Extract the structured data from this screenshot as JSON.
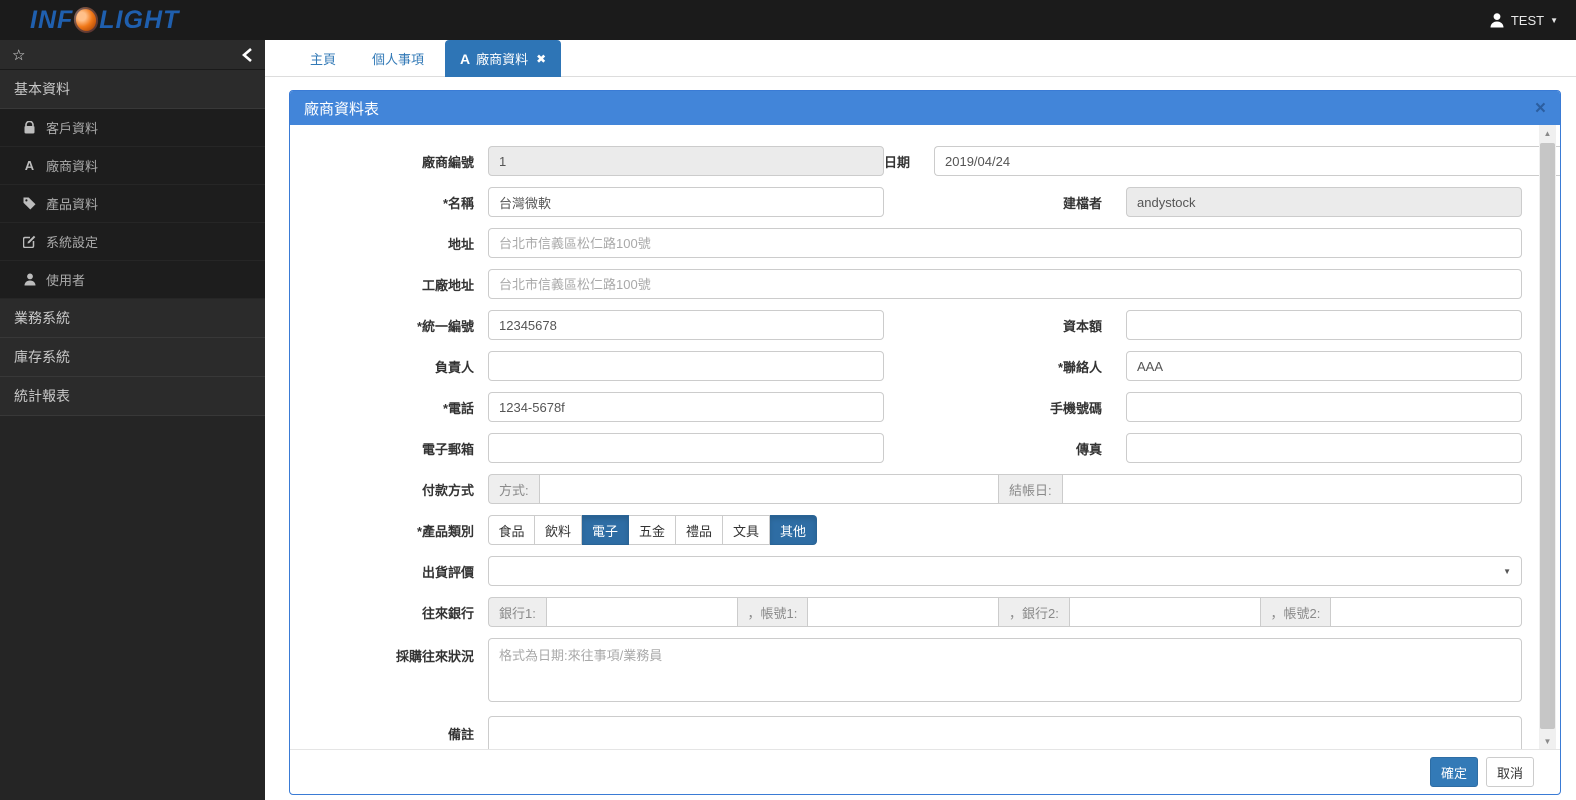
{
  "topbar": {
    "logo": {
      "part1": "INF",
      "part2": "LIGHT"
    },
    "user": {
      "name": "TEST"
    }
  },
  "sidebar": {
    "sections": [
      {
        "label": "基本資料",
        "items": [
          {
            "icon": "lock-icon",
            "label": "客戶資料"
          },
          {
            "icon": "font-a-icon",
            "label": "廠商資料"
          },
          {
            "icon": "tag-icon",
            "label": "產品資料"
          },
          {
            "icon": "edit-icon",
            "label": "系統設定"
          },
          {
            "icon": "user-icon",
            "label": "使用者"
          }
        ]
      },
      {
        "label": "業務系統",
        "items": []
      },
      {
        "label": "庫存系統",
        "items": []
      },
      {
        "label": "統計報表",
        "items": []
      }
    ]
  },
  "tabs": {
    "home": {
      "label": "主頁"
    },
    "personal": {
      "label": "個人事項"
    },
    "vendor": {
      "label": "廠商資料",
      "icon": "font-a-icon",
      "close": "✖",
      "active": true
    }
  },
  "modal": {
    "title": "廠商資料表",
    "close": "×",
    "fields": {
      "vendor_id": {
        "label": "廠商編號",
        "value": "1",
        "disabled": true
      },
      "date": {
        "label": "日期",
        "value": "2019/04/24"
      },
      "name": {
        "label": "*名稱",
        "value": "台灣微軟"
      },
      "creator": {
        "label": "建檔者",
        "value": "andystock",
        "disabled": true
      },
      "address": {
        "label": "地址",
        "placeholder": "台北市信義區松仁路100號"
      },
      "factory_address": {
        "label": "工廠地址",
        "placeholder": "台北市信義區松仁路100號"
      },
      "tax_id": {
        "label": "*統一編號",
        "value": "12345678"
      },
      "capital": {
        "label": "資本額",
        "value": ""
      },
      "owner": {
        "label": "負責人",
        "value": ""
      },
      "contact": {
        "label": "*聯絡人",
        "value": "AAA"
      },
      "phone": {
        "label": "*電話",
        "value": "1234-5678f"
      },
      "mobile": {
        "label": "手機號碼",
        "value": ""
      },
      "email": {
        "label": "電子郵箱",
        "value": ""
      },
      "fax": {
        "label": "傳真",
        "value": ""
      },
      "payment": {
        "label": "付款方式",
        "addon_method": "方式:",
        "addon_closing": "結帳日:"
      },
      "category": {
        "label": "*產品類別",
        "options": [
          {
            "label": "食品",
            "selected": false
          },
          {
            "label": "飲料",
            "selected": false
          },
          {
            "label": "電子",
            "selected": true
          },
          {
            "label": "五金",
            "selected": false
          },
          {
            "label": "禮品",
            "selected": false
          },
          {
            "label": "文具",
            "selected": false
          },
          {
            "label": "其他",
            "selected": true
          }
        ]
      },
      "rating": {
        "label": "出貨評價",
        "value": ""
      },
      "banks": {
        "label": "往來銀行",
        "addons": [
          "銀行1:",
          "，帳號1:",
          "，銀行2:",
          "，帳號2:"
        ]
      },
      "purchase_status": {
        "label": "採購往來狀況",
        "placeholder": "格式為日期:來往事項/業務員"
      },
      "remark": {
        "label": "備註",
        "value": ""
      }
    },
    "footer": {
      "ok": "確定",
      "cancel": "取消"
    }
  },
  "colors": {
    "topbar_bg": "#1b1b1b",
    "modal_header_blue": "#4285d9",
    "active_tab_blue": "#2e75b6",
    "primary_button": "#337ab7",
    "selected_category": "#2e6da4"
  }
}
